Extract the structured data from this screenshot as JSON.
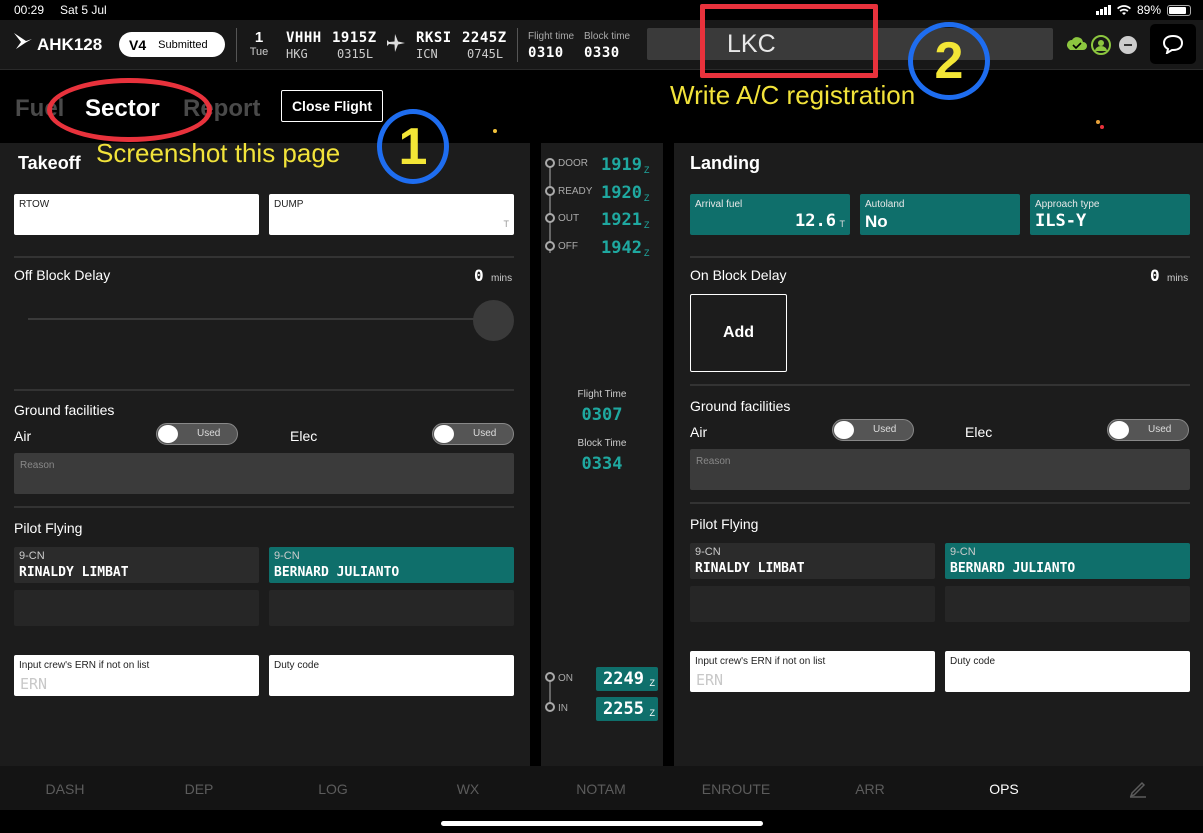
{
  "status": {
    "time": "00:29",
    "date": "Sat 5 Jul",
    "battery": "89%"
  },
  "header": {
    "flight": "AHK128",
    "version": "V4",
    "status": "Submitted",
    "day_num": "1",
    "day_name": "Tue",
    "dep_code": "VHHH",
    "dep_time_z": "1915Z",
    "dep_iata": "HKG",
    "dep_local": "0315L",
    "arr_code": "RKSI",
    "arr_time_z": "2245Z",
    "arr_iata": "ICN",
    "arr_local": "0745L",
    "flight_time_label": "Flight time",
    "flight_time": "0310",
    "block_time_label": "Block time",
    "block_time": "0330",
    "registration": "LKC"
  },
  "annotations": {
    "circle1": "1",
    "circle2": "2",
    "text1": "Screenshot this page",
    "text2": "Write A/C registration"
  },
  "tabs": {
    "fuel": "Fuel",
    "sector": "Sector",
    "report": "Report",
    "close_flight": "Close Flight"
  },
  "takeoff": {
    "title": "Takeoff",
    "rtow_label": "RTOW",
    "dump_label": "DUMP",
    "dump_unit": "T",
    "delay_label": "Off Block Delay",
    "delay_value": "0",
    "delay_unit": "mins",
    "ground_label": "Ground facilities",
    "air_label": "Air",
    "elec_label": "Elec",
    "used_label": "Used",
    "reason_placeholder": "Reason",
    "pilot_flying_label": "Pilot Flying",
    "pilot1_role": "9-CN",
    "pilot1_name": "RINALDY LIMBAT",
    "pilot2_role": "9-CN",
    "pilot2_name": "BERNARD JULIANTO",
    "ern_label": "Input crew's ERN if not on list",
    "ern_placeholder": "ERN",
    "duty_label": "Duty code"
  },
  "timeline": {
    "door_label": "DOOR",
    "door": "1919",
    "ready_label": "READY",
    "ready": "1920",
    "out_label": "OUT",
    "out": "1921",
    "off_label": "OFF",
    "off": "1942",
    "z": "Z",
    "flight_time_label": "Flight Time",
    "flight_time": "0307",
    "block_time_label": "Block Time",
    "block_time": "0334",
    "on_label": "ON",
    "on": "2249",
    "in_label": "IN",
    "in": "2255"
  },
  "landing": {
    "title": "Landing",
    "arrival_fuel_label": "Arrival fuel",
    "arrival_fuel": "12.6",
    "arrival_fuel_unit": "T",
    "autoland_label": "Autoland",
    "autoland": "No",
    "approach_label": "Approach type",
    "approach": "ILS-Y",
    "delay_label": "On Block Delay",
    "delay_value": "0",
    "delay_unit": "mins",
    "add_label": "Add",
    "ground_label": "Ground facilities",
    "air_label": "Air",
    "elec_label": "Elec",
    "used_label": "Used",
    "reason_placeholder": "Reason",
    "pilot_flying_label": "Pilot Flying",
    "pilot1_role": "9-CN",
    "pilot1_name": "RINALDY LIMBAT",
    "pilot2_role": "9-CN",
    "pilot2_name": "BERNARD JULIANTO",
    "ern_label": "Input crew's ERN if not on list",
    "ern_placeholder": "ERN",
    "duty_label": "Duty code"
  },
  "nav": [
    "DASH",
    "DEP",
    "LOG",
    "WX",
    "NOTAM",
    "ENROUTE",
    "ARR",
    "OPS"
  ],
  "colors": {
    "teal": "#0f6f6b",
    "teal_text": "#1fa8a0",
    "annotation_red": "#e8323c",
    "annotation_blue": "#1e6df0",
    "annotation_yellow": "#f2e33a"
  }
}
